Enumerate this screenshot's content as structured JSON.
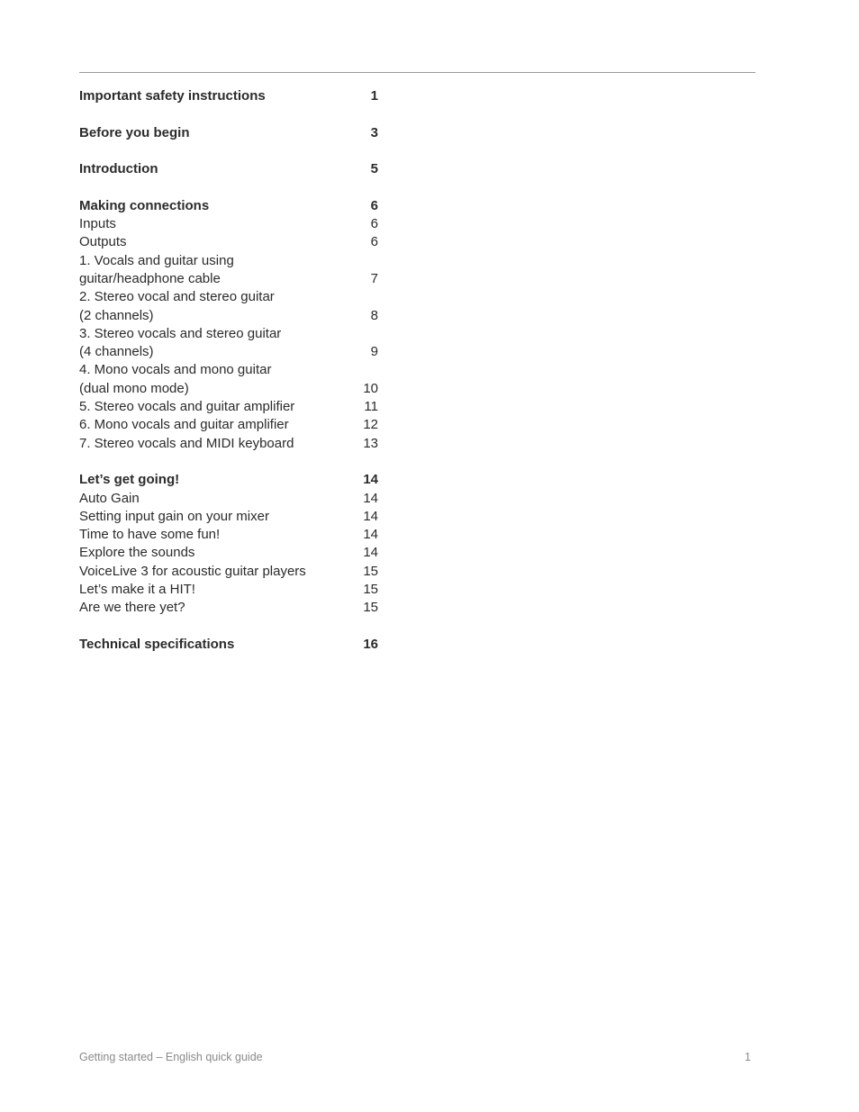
{
  "toc": {
    "sections": [
      {
        "entries": [
          {
            "title": "Important safety instructions",
            "page": "1",
            "bold": true
          }
        ]
      },
      {
        "entries": [
          {
            "title": "Before you begin",
            "page": "3",
            "bold": true
          }
        ]
      },
      {
        "entries": [
          {
            "title": "Introduction",
            "page": "5",
            "bold": true
          }
        ]
      },
      {
        "entries": [
          {
            "title": "Making connections",
            "page": "6",
            "bold": true
          },
          {
            "title": "Inputs",
            "page": "6",
            "bold": false
          },
          {
            "title": "Outputs",
            "page": "6",
            "bold": false
          },
          {
            "title": "1. Vocals and guitar using\nguitar/headphone cable",
            "page": "7",
            "bold": false
          },
          {
            "title": "2. Stereo vocal and stereo guitar\n(2 channels)",
            "page": "8",
            "bold": false
          },
          {
            "title": "3. Stereo vocals and stereo guitar\n(4 channels)",
            "page": "9",
            "bold": false
          },
          {
            "title": "4. Mono vocals and mono guitar\n(dual mono mode)",
            "page": "10",
            "bold": false
          },
          {
            "title": "5. Stereo vocals and guitar amplifier",
            "page": "11",
            "bold": false
          },
          {
            "title": "6. Mono vocals and guitar amplifier",
            "page": "12",
            "bold": false
          },
          {
            "title": "7. Stereo vocals and MIDI keyboard",
            "page": "13",
            "bold": false
          }
        ]
      },
      {
        "entries": [
          {
            "title": "Let’s get going!",
            "page": "14",
            "bold": true
          },
          {
            "title": "Auto Gain",
            "page": "14",
            "bold": false
          },
          {
            "title": "Setting input gain on your mixer",
            "page": "14",
            "bold": false
          },
          {
            "title": "Time to have some fun!",
            "page": "14",
            "bold": false
          },
          {
            "title": "Explore the sounds",
            "page": "14",
            "bold": false
          },
          {
            "title": "VoiceLive 3 for acoustic guitar players",
            "page": "15",
            "bold": false
          },
          {
            "title": "Let’s make it a HIT!",
            "page": "15",
            "bold": false
          },
          {
            "title": "Are we there yet?",
            "page": "15",
            "bold": false
          }
        ]
      },
      {
        "entries": [
          {
            "title": "Technical specifications",
            "page": "16",
            "bold": true
          }
        ]
      }
    ]
  },
  "footer": {
    "left": "Getting started – English quick guide",
    "page_number": "1"
  }
}
